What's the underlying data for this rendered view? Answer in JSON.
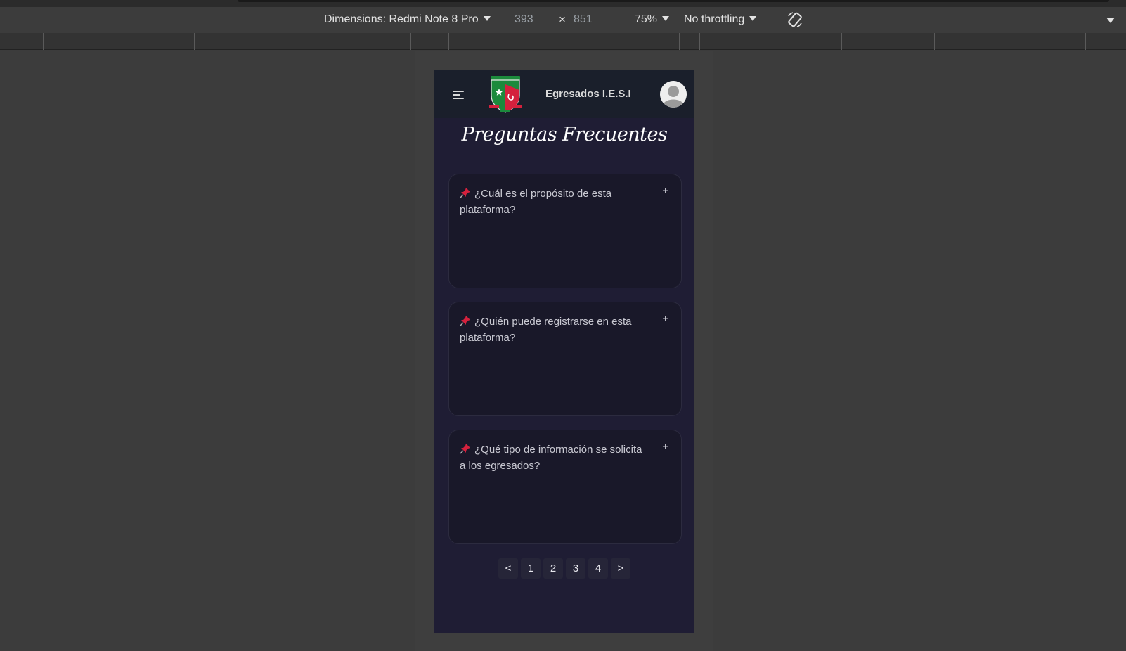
{
  "devtools": {
    "dimensions_label": "Dimensions: Redmi Note 8 Pro",
    "width": "393",
    "x_sign": "×",
    "height": "851",
    "zoom": "75%",
    "throttling": "No throttling"
  },
  "app": {
    "title": "Egresados I.E.S.I",
    "page_title": "Preguntas Frecuentes"
  },
  "faqs": [
    {
      "question": "¿Cuál es el propósito de esta plataforma?",
      "toggle": "+"
    },
    {
      "question": "¿Quién puede registrarse en esta plataforma?",
      "toggle": "+"
    },
    {
      "question": "¿Qué tipo de información se solicita a los egresados?",
      "toggle": "+"
    }
  ],
  "pagination": {
    "prev": "<",
    "pages": [
      "1",
      "2",
      "3",
      "4"
    ],
    "next": ">"
  },
  "colors": {
    "app_background": "#1f1d34",
    "header_background": "#1a1f2b",
    "card_background": "#191829",
    "pin_red": "#d4213d",
    "logo_green": "#1b8a3c"
  }
}
